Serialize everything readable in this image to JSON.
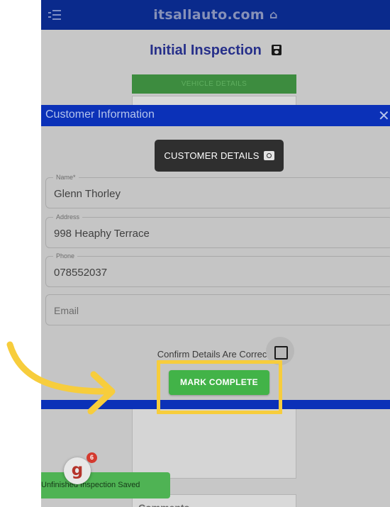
{
  "app": {
    "brand": "itsallauto.com",
    "page_title": "Initial Inspection",
    "vehicle_details_label": "VEHICLE DETAILS",
    "comments_label": "Comments"
  },
  "modal": {
    "title": "Customer Information",
    "close_glyph": "✕",
    "customer_details_label": "CUSTOMER DETAILS",
    "fields": [
      {
        "label": "Name*",
        "value": "Glenn Thorley"
      },
      {
        "label": "Address",
        "value": "998 Heaphy Terrace"
      },
      {
        "label": "Phone",
        "value": "078552037"
      }
    ],
    "email_placeholder": "Email",
    "confirm_label": "Confirm Details Are Correct",
    "confirm_checked": false,
    "mark_complete_label": "MARK COMPLETE"
  },
  "toast": {
    "text": "Unfinished Inspection Saved"
  },
  "badge": {
    "logo_letter": "g",
    "count": "6"
  },
  "colors": {
    "topbar": "#0a2a8c",
    "modal_header": "#0b31b8",
    "mark_complete": "#42b348",
    "highlight": "#f7cd3c"
  },
  "icons": {
    "menu": "menu-icon",
    "home": "home-icon",
    "save": "save-icon",
    "camera": "camera-icon",
    "close": "close-icon"
  }
}
